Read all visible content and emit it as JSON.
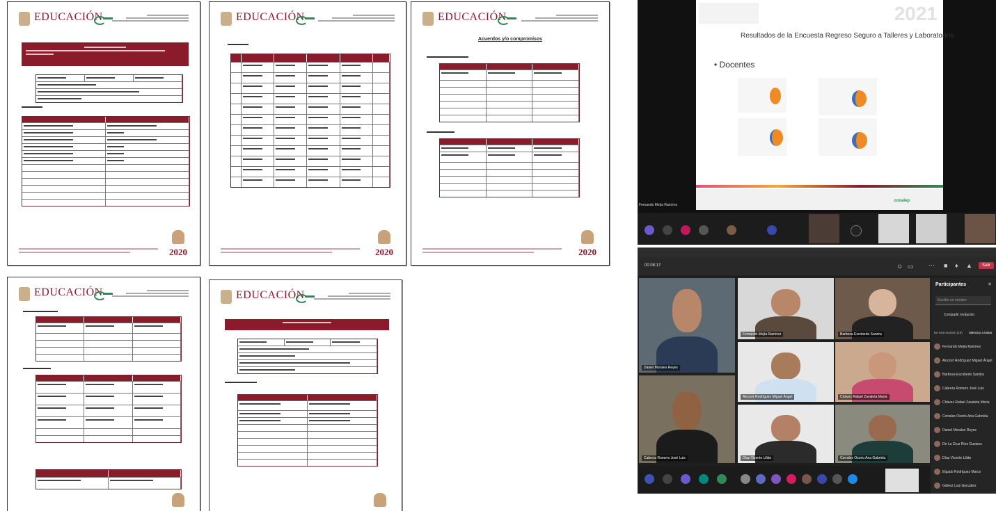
{
  "documents": {
    "brand": "EDUCACIÓN",
    "logo": "conalep",
    "year": "2020",
    "doc3_title": "Acuerdos y/o compromisos"
  },
  "meeting_top": {
    "slide_title": "Resultados de la Encuesta Regreso Seguro a Talleres y Laboratorios",
    "slide_bullet": "Docentes",
    "slide_year": "2021",
    "slide_footer_logo": "conalep",
    "presenter_name": "Fernando Mejía Ramírez"
  },
  "meeting_bottom": {
    "toolbar_time": "00:08:17",
    "leave_label": "Salir",
    "panel_title": "Participantes",
    "search_placeholder": "Escribe un nombre",
    "share_invite": "Compartir invitación",
    "in_meeting_label": "En esta reunión (19)",
    "mute_all": "Silenciar a todos",
    "participants": [
      "Fernando Mejía Ramírez",
      "Alcocer Rodríguez Miguel Ángel",
      "Barbosa Escobedo Sandra",
      "Cabrera Romero José Luis",
      "Chávez Rafael Zavaleta María",
      "Corrales Osorio Ana Gabriela",
      "Daniel Morales Reyes",
      "De La Cruz Ríos Gustavo",
      "Díaz Vicente Lilián",
      "Elgado Rodríguez Marco",
      "Gálvez Luis Gonzalez"
    ],
    "tiles": [
      {
        "name": "Daniel Morales Reyes"
      },
      {
        "name": "Fernando Mejía Ramírez"
      },
      {
        "name": "Barbosa Escobedo Sandra"
      },
      {
        "name": "Alcocer Rodríguez Miguel Ángel"
      },
      {
        "name": "Chávez Rafael Zavaleta María"
      },
      {
        "name": "Cabrera Romero José Luis"
      },
      {
        "name": "Díaz Vicente Lilián"
      },
      {
        "name": "Corrales Osorio Ana Gabriela"
      }
    ]
  }
}
